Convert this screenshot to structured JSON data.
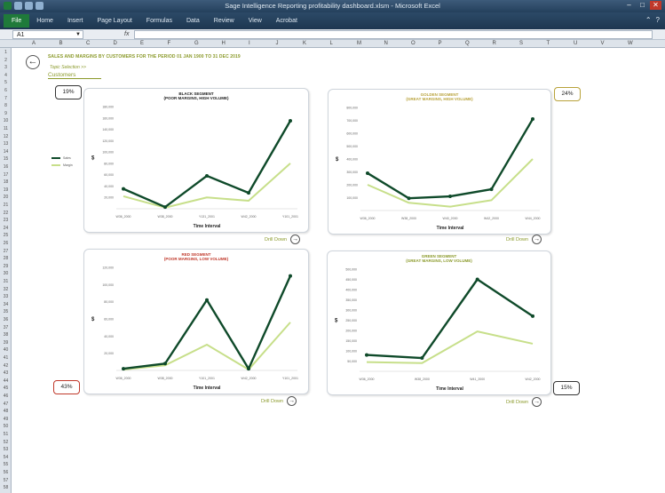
{
  "window": {
    "title": "Sage Intelligence Reporting profitability dashboard.xlsm - Microsoft Excel"
  },
  "ribbon": {
    "tabs": [
      "File",
      "Home",
      "Insert",
      "Page Layout",
      "Formulas",
      "Data",
      "Review",
      "View",
      "Acrobat"
    ]
  },
  "formula_bar": {
    "name_box": "A1",
    "fx": "fx",
    "value": ""
  },
  "column_headers": [
    "A",
    "B",
    "C",
    "D",
    "E",
    "F",
    "G",
    "H",
    "I",
    "J",
    "K",
    "L",
    "M",
    "N",
    "O",
    "P",
    "Q",
    "R",
    "S",
    "T",
    "U",
    "V",
    "W"
  ],
  "row_headers": [
    "1",
    "2",
    "3",
    "4",
    "5",
    "6",
    "7",
    "8",
    "9",
    "10",
    "11",
    "12",
    "13",
    "14",
    "15",
    "16",
    "17",
    "18",
    "19",
    "20",
    "21",
    "22",
    "23",
    "24",
    "25",
    "26",
    "27",
    "28",
    "29",
    "30",
    "31",
    "32",
    "33",
    "34",
    "35",
    "36",
    "37",
    "38",
    "39",
    "40",
    "41",
    "42",
    "43",
    "44",
    "45",
    "46",
    "47",
    "48",
    "49",
    "50",
    "51",
    "52",
    "53",
    "54",
    "55",
    "56",
    "57",
    "58"
  ],
  "page": {
    "title": "SALES AND MARGINS BY CUSTOMERS FOR THE PERIOD 01 JAN 1900 TO 31 DEC 2019",
    "breadcrumb": "Topic Selection >>",
    "section": "Customers",
    "back_icon": "back-arrow-icon"
  },
  "legend": {
    "sales": "Sales",
    "margin": "Margin"
  },
  "colors": {
    "sales": "#0f4a2a",
    "margin": "#c7df8a",
    "accent": "#8b9a2b"
  },
  "drill_label": "Drill Down",
  "segments": {
    "black": {
      "title": "BLACK SEGMENT",
      "subtitle": "(POOR MARGINS, HIGH VOLUME)",
      "badge": "19%",
      "badge_color": "#333333",
      "title_color": "#222222"
    },
    "golden": {
      "title": "GOLDEN SEGMENT",
      "subtitle": "(GREAT MARGINS, HIGH VOLUME)",
      "badge": "24%",
      "badge_color": "#b8a23a",
      "title_color": "#b8a23a"
    },
    "red": {
      "title": "RED SEGMENT",
      "subtitle": "(POOR MARGINS, LOW VOLUME)",
      "badge": "43%",
      "badge_color": "#c0392b",
      "title_color": "#c0392b"
    },
    "green": {
      "title": "GREEN SEGMENT",
      "subtitle": "(GREAT MARGINS, LOW VOLUME)",
      "badge": "15%",
      "badge_color": "#333333",
      "title_color": "#8b9a2b"
    }
  },
  "chart_data": [
    {
      "type": "line",
      "id": "black",
      "title": "BLACK SEGMENT",
      "subtitle": "(POOR MARGINS, HIGH VOLUME)",
      "xlabel": "Time Interval",
      "ylabel": "$",
      "categories": [
        "W36_2000",
        "W38_2000",
        "Y131_2001",
        "W42_2000",
        "Y101_2001"
      ],
      "ylim": [
        0,
        180000
      ],
      "yticks": [
        "20,000",
        "40,000",
        "60,000",
        "80,000",
        "100,000",
        "120,000",
        "140,000",
        "160,000",
        "180,000"
      ],
      "series": [
        {
          "name": "Sales",
          "values": [
            35000,
            3000,
            58000,
            28000,
            155000
          ]
        },
        {
          "name": "Margin",
          "values": [
            22000,
            2000,
            20000,
            14000,
            80000
          ]
        }
      ]
    },
    {
      "type": "line",
      "id": "golden",
      "title": "GOLDEN SEGMENT",
      "subtitle": "(GREAT MARGINS, HIGH VOLUME)",
      "xlabel": "Time Interval",
      "ylabel": "$",
      "categories": [
        "W36_2000",
        "W38_2000",
        "W40_2000",
        "W42_2000",
        "W44_2000"
      ],
      "ylim": [
        0,
        800000
      ],
      "yticks": [
        "100,000",
        "200,000",
        "300,000",
        "400,000",
        "500,000",
        "600,000",
        "700,000",
        "800,000"
      ],
      "series": [
        {
          "name": "Sales",
          "values": [
            290000,
            95000,
            110000,
            165000,
            710000
          ]
        },
        {
          "name": "Margin",
          "values": [
            200000,
            60000,
            30000,
            80000,
            400000
          ]
        }
      ]
    },
    {
      "type": "line",
      "id": "red",
      "title": "RED SEGMENT",
      "subtitle": "(POOR MARGINS, LOW VOLUME)",
      "xlabel": "Time Interval",
      "ylabel": "$",
      "categories": [
        "W36_2000",
        "W38_2000",
        "Y101_2001",
        "W42_2000",
        "Y101_2001"
      ],
      "ylim": [
        0,
        120000
      ],
      "yticks": [
        "20,000",
        "40,000",
        "60,000",
        "80,000",
        "100,000",
        "120,000"
      ],
      "series": [
        {
          "name": "Sales",
          "values": [
            2000,
            8000,
            82000,
            2000,
            110000
          ]
        },
        {
          "name": "Margin",
          "values": [
            1000,
            6000,
            30000,
            1000,
            56000
          ]
        }
      ]
    },
    {
      "type": "line",
      "id": "green",
      "title": "GREEN SEGMENT",
      "subtitle": "(GREAT MARGINS, LOW VOLUME)",
      "xlabel": "Time Interval",
      "ylabel": "$",
      "categories": [
        "W36_2000",
        "W38_2000",
        "W41_2000",
        "W42_2000"
      ],
      "ylim": [
        0,
        500000
      ],
      "yticks": [
        "50,000",
        "100,000",
        "150,000",
        "200,000",
        "250,000",
        "300,000",
        "350,000",
        "400,000",
        "450,000",
        "500,000"
      ],
      "series": [
        {
          "name": "Sales",
          "values": [
            80000,
            65000,
            450000,
            270000
          ]
        },
        {
          "name": "Margin",
          "values": [
            45000,
            40000,
            195000,
            135000
          ]
        }
      ]
    }
  ]
}
